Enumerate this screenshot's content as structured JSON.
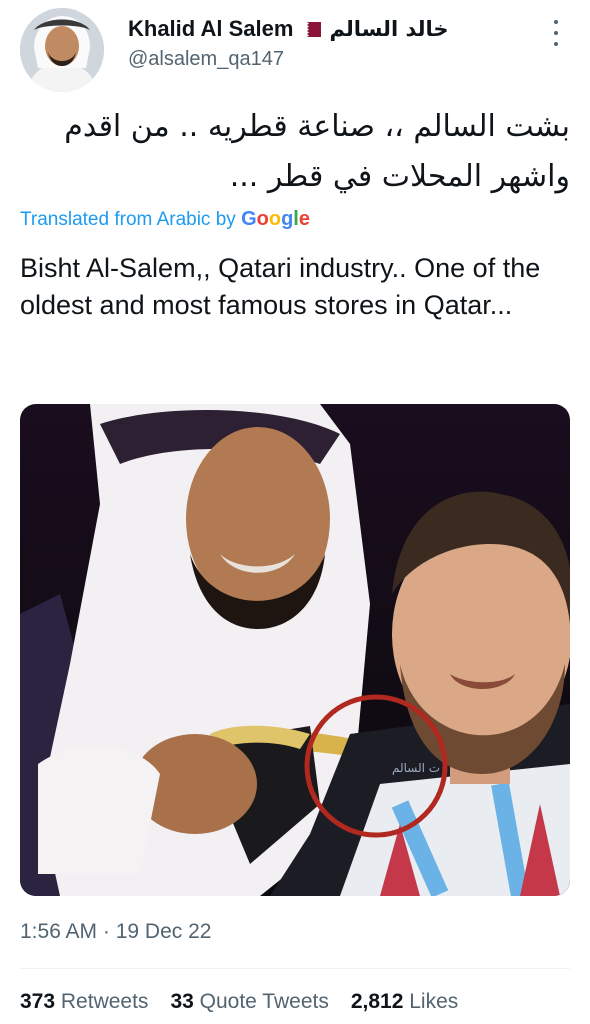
{
  "author": {
    "display_name": "Khalid Al Salem",
    "arabic_name": "خالد السالم",
    "handle": "@alsalem_qa147",
    "flag_icon": "qatar-flag-icon"
  },
  "tweet": {
    "arabic_line1": "بشت السالم ،، صناعة قطريه .. من اقدم",
    "arabic_line2": "واشهر المحلات في قطر ...",
    "translated_label": "Translated from Arabic by",
    "google": "Google",
    "translation": "Bisht Al-Salem,, Qatari industry.. One of the oldest and most famous stores in Qatar...",
    "timestamp": "1:56 AM · 19 Dec 22"
  },
  "stats": {
    "retweets_count": "373",
    "retweets_label": "Retweets",
    "quotes_count": "33",
    "quotes_label": "Quote Tweets",
    "likes_count": "2,812",
    "likes_label": "Likes"
  },
  "colors": {
    "link": "#1d9bf0",
    "secondary_text": "#536471",
    "primary_text": "#0f1419",
    "highlight_circle": "#b0281f"
  }
}
